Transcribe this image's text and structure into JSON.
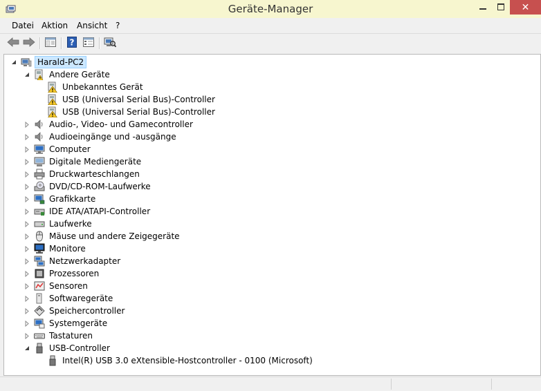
{
  "window": {
    "title": "Geräte-Manager",
    "close_glyph": "✕"
  },
  "menu": [
    "Datei",
    "Aktion",
    "Ansicht",
    "?"
  ],
  "toolbar": {
    "buttons": [
      "back-arrow-icon",
      "forward-arrow-icon",
      "console-tree-icon",
      "help-icon",
      "properties-icon",
      "scan-hardware-icon"
    ]
  },
  "tree": {
    "root": "Harald-PC2",
    "categories": [
      {
        "label": "Andere Geräte",
        "expanded": true,
        "icon": "unknown-device-icon",
        "children": [
          "Unbekanntes Gerät",
          "USB (Universal Serial Bus)-Controller",
          "USB (Universal Serial Bus)-Controller"
        ]
      },
      {
        "label": "Audio-, Video- und Gamecontroller",
        "expanded": false,
        "icon": "speaker-icon"
      },
      {
        "label": "Audioeingänge und -ausgänge",
        "expanded": false,
        "icon": "speaker-icon"
      },
      {
        "label": "Computer",
        "expanded": false,
        "icon": "computer-icon"
      },
      {
        "label": "Digitale Mediengeräte",
        "expanded": false,
        "icon": "media-device-icon"
      },
      {
        "label": "Druckwarteschlangen",
        "expanded": false,
        "icon": "printer-icon"
      },
      {
        "label": "DVD/CD-ROM-Laufwerke",
        "expanded": false,
        "icon": "dvd-drive-icon"
      },
      {
        "label": "Grafikkarte",
        "expanded": false,
        "icon": "display-adapter-icon"
      },
      {
        "label": "IDE ATA/ATAPI-Controller",
        "expanded": false,
        "icon": "ide-controller-icon"
      },
      {
        "label": "Laufwerke",
        "expanded": false,
        "icon": "disk-drive-icon"
      },
      {
        "label": "Mäuse und andere Zeigegeräte",
        "expanded": false,
        "icon": "mouse-icon"
      },
      {
        "label": "Monitore",
        "expanded": false,
        "icon": "monitor-icon"
      },
      {
        "label": "Netzwerkadapter",
        "expanded": false,
        "icon": "network-adapter-icon"
      },
      {
        "label": "Prozessoren",
        "expanded": false,
        "icon": "processor-icon"
      },
      {
        "label": "Sensoren",
        "expanded": false,
        "icon": "sensor-icon"
      },
      {
        "label": "Softwaregeräte",
        "expanded": false,
        "icon": "software-device-icon"
      },
      {
        "label": "Speichercontroller",
        "expanded": false,
        "icon": "storage-controller-icon"
      },
      {
        "label": "Systemgeräte",
        "expanded": false,
        "icon": "system-device-icon"
      },
      {
        "label": "Tastaturen",
        "expanded": false,
        "icon": "keyboard-icon"
      },
      {
        "label": "USB-Controller",
        "expanded": true,
        "icon": "usb-icon",
        "children": [
          "Intel(R) USB 3.0 eXtensible-Hostcontroller - 0100 (Microsoft)"
        ]
      }
    ]
  }
}
